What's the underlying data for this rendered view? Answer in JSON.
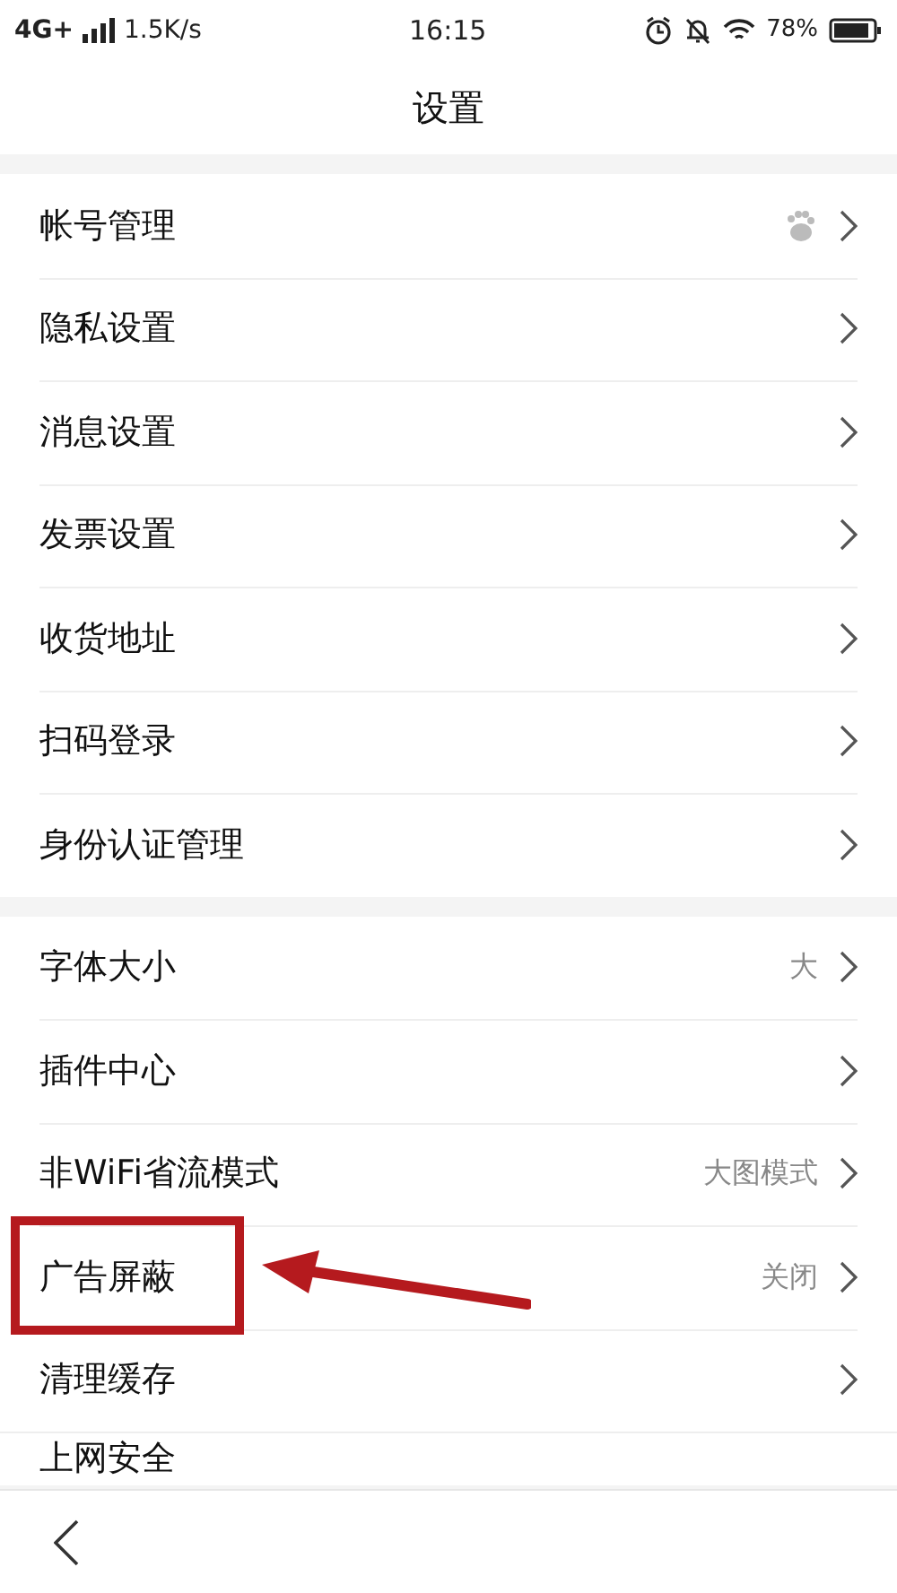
{
  "status_bar": {
    "network": "4G+",
    "speed": "1.5K/s",
    "time": "16:15",
    "battery": "78%"
  },
  "header": {
    "title": "设置"
  },
  "groups": [
    {
      "items": [
        {
          "label": "帐号管理",
          "kind": "icon"
        },
        {
          "label": "隐私设置",
          "kind": "plain"
        },
        {
          "label": "消息设置",
          "kind": "plain"
        },
        {
          "label": "发票设置",
          "kind": "plain"
        },
        {
          "label": "收货地址",
          "kind": "plain"
        },
        {
          "label": "扫码登录",
          "kind": "plain"
        },
        {
          "label": "身份认证管理",
          "kind": "plain"
        }
      ]
    },
    {
      "items": [
        {
          "label": "字体大小",
          "kind": "value",
          "value": "大"
        },
        {
          "label": "插件中心",
          "kind": "plain"
        },
        {
          "label": "非WiFi省流模式",
          "kind": "value",
          "value": "大图模式"
        },
        {
          "label": "广告屏蔽",
          "kind": "value",
          "value": "关闭",
          "highlighted": true
        },
        {
          "label": "清理缓存",
          "kind": "plain"
        },
        {
          "label": "上网安全",
          "kind": "cut"
        }
      ]
    }
  ]
}
